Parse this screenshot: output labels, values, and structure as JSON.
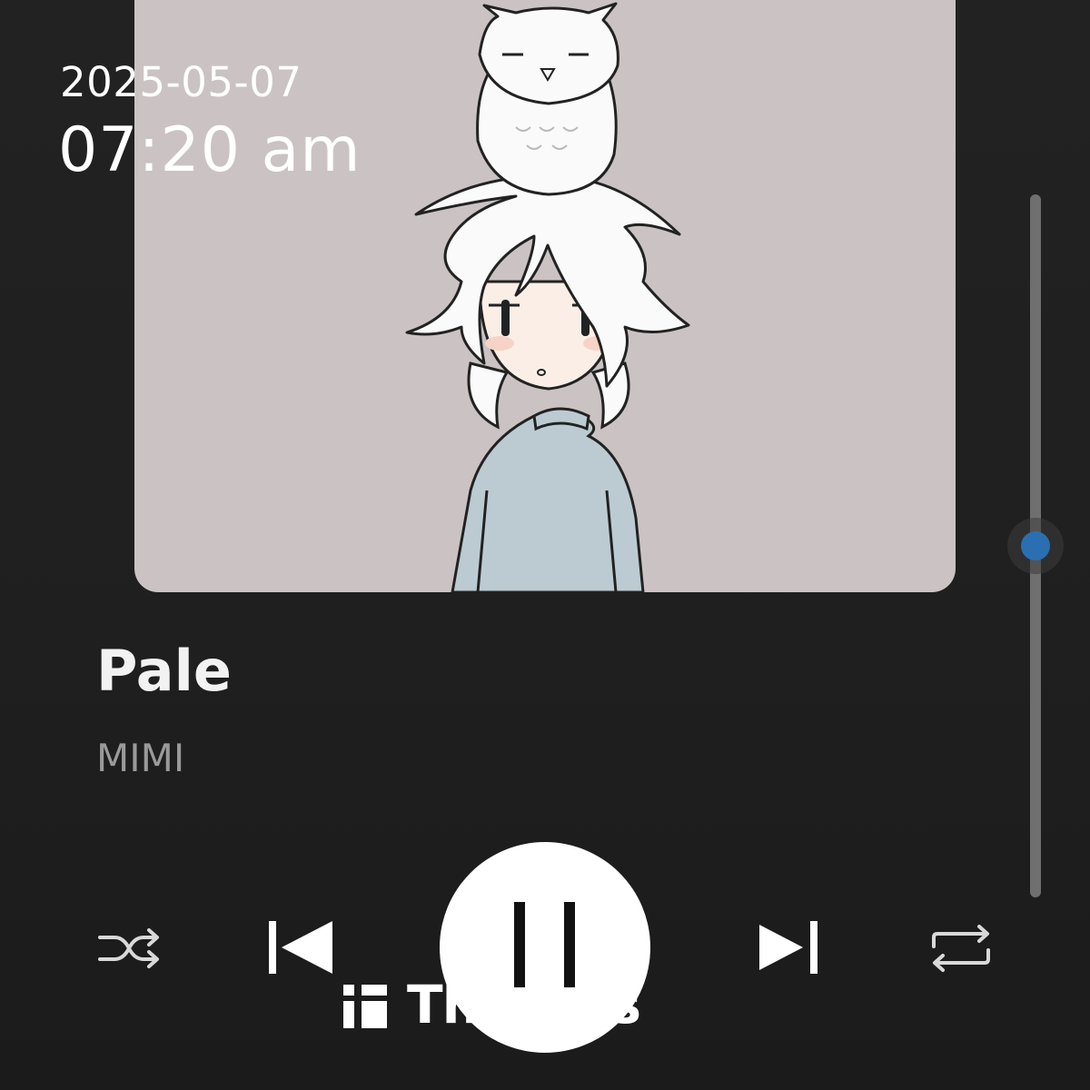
{
  "status": {
    "date": "2025-05-07",
    "time": "07:20 am"
  },
  "track": {
    "title": "Pale",
    "artist": "MIMI"
  },
  "volume": {
    "level_percent": 50,
    "accent_color": "#2b6fb3"
  },
  "controls": {
    "shuffle_icon": "shuffle-icon",
    "previous_icon": "skip-previous-icon",
    "play_pause_icon": "pause-icon",
    "next_icon": "skip-next-icon",
    "repeat_icon": "repeat-icon"
  },
  "watermark": {
    "text": "Threads",
    "icon": "threads-logo-icon"
  },
  "colors": {
    "background": "#1f1f1f",
    "album_background": "#cbc3c3",
    "title": "#f2f2f2",
    "artist": "#9a9a9a"
  }
}
